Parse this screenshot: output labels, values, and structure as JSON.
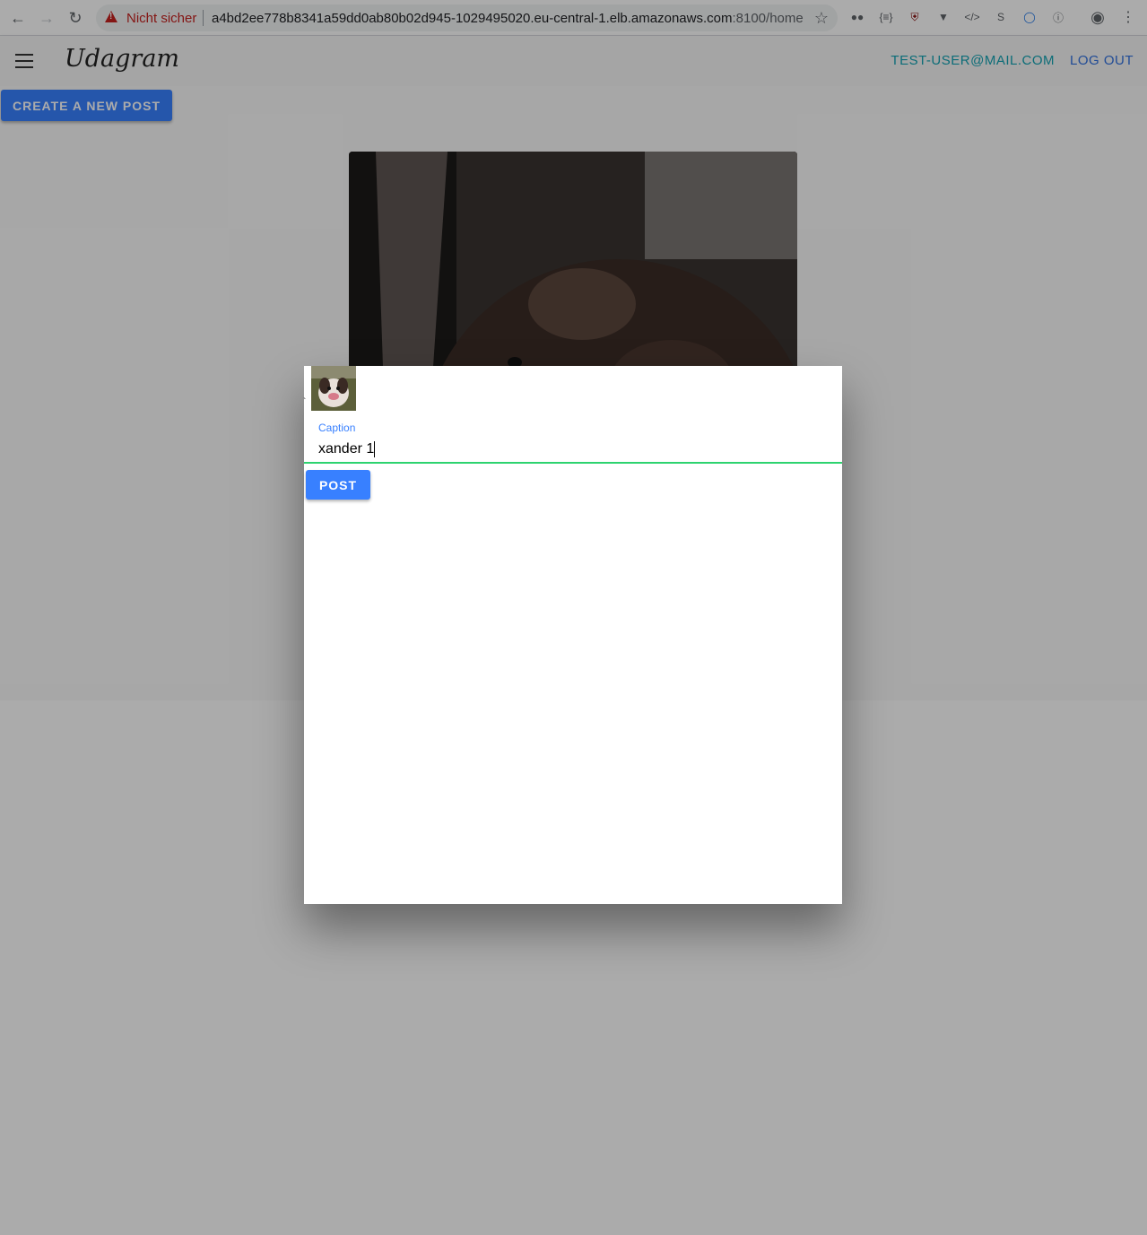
{
  "browser": {
    "security_label": "Nicht sicher",
    "url_host": "a4bd2ee778b8341a59dd0ab80b02d945-1029495020.eu-central-1.elb.amazonaws.com",
    "url_path": ":8100/home"
  },
  "header": {
    "logo": "Udagram",
    "user_email": "TEST-USER@MAIL.COM",
    "logout_label": "LOG OUT"
  },
  "main": {
    "create_post_label": "CREATE A NEW POST"
  },
  "modal": {
    "caption_label": "Caption",
    "caption_value": "xander 1",
    "post_label": "POST"
  },
  "colors": {
    "primary": "#3880ff",
    "secondary": "#12a3b4",
    "success": "#2dd36f",
    "danger": "#c5221f"
  }
}
